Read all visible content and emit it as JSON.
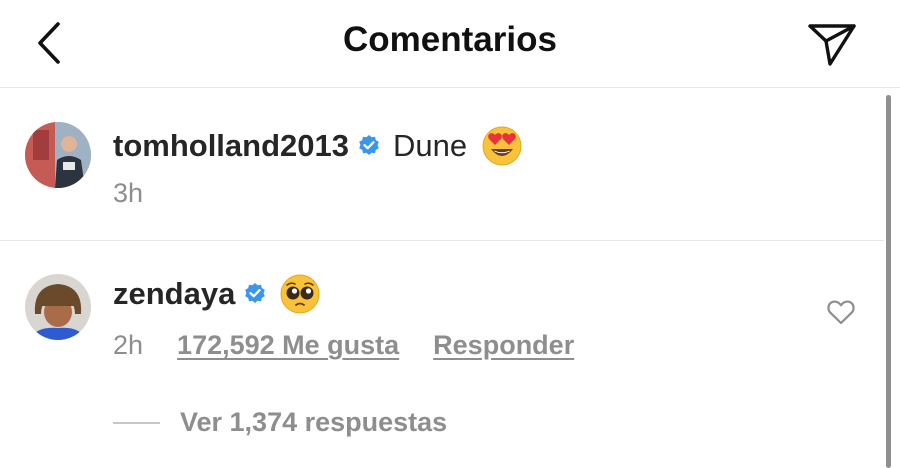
{
  "header": {
    "title": "Comentarios",
    "back_icon": "chevron-left-icon",
    "share_icon": "paper-plane-icon"
  },
  "caption": {
    "username": "tomholland2013",
    "verified": true,
    "text": "Dune",
    "emoji_icon": "heart-eyes-emoji-icon",
    "time": "3h"
  },
  "comment": {
    "username": "zendaya",
    "verified": true,
    "emoji_icon": "pleading-face-emoji-icon",
    "time": "2h",
    "likes_label": "172,592 Me gusta",
    "reply_label": "Responder",
    "like_icon": "heart-outline-icon",
    "view_replies_label": "Ver 1,374 respuestas"
  },
  "colors": {
    "text": "#262626",
    "secondary": "#8e8e8e",
    "verified_blue": "#3797f0",
    "divider": "#e6e6e6"
  }
}
